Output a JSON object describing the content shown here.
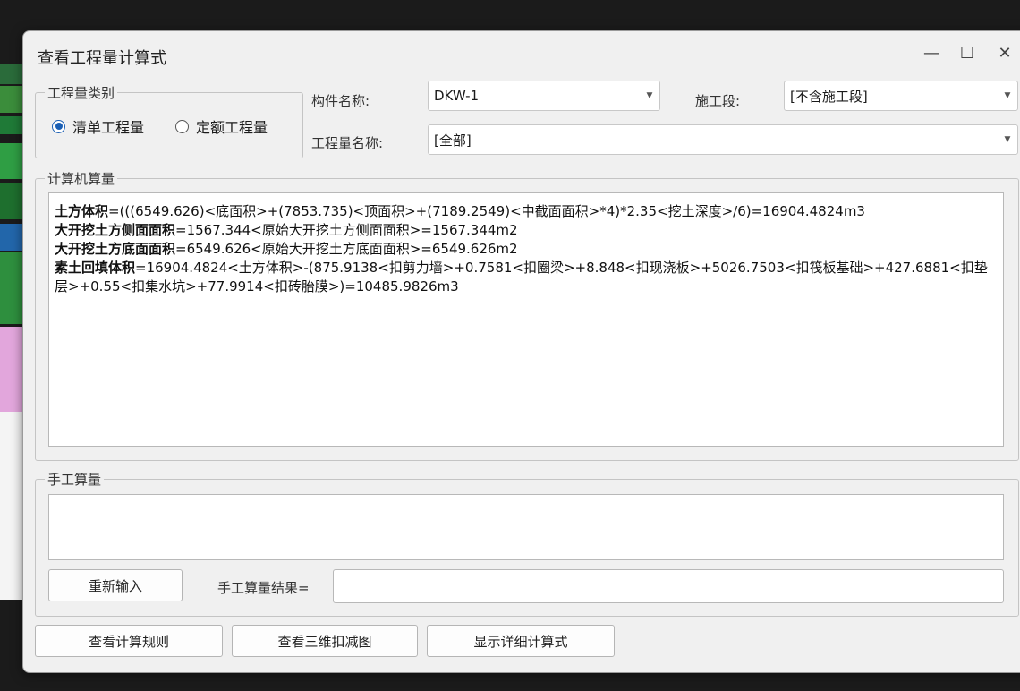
{
  "dialog": {
    "title": "查看工程量计算式",
    "minimize": "—",
    "maximize": "☐",
    "close": "✕"
  },
  "quantity_type": {
    "legend": "工程量类别",
    "options": [
      {
        "label": "清单工程量",
        "selected": true
      },
      {
        "label": "定额工程量",
        "selected": false
      }
    ]
  },
  "fields": {
    "component_name_label": "构件名称:",
    "component_name_value": "DKW-1",
    "stage_label": "施工段:",
    "stage_value": "[不含施工段]",
    "quantity_name_label": "工程量名称:",
    "quantity_name_value": "[全部]"
  },
  "computer": {
    "legend": "计算机算量",
    "lines": [
      {
        "name": "土方体积",
        "expr": "=(((6549.626)<底面积>+(7853.735)<顶面积>+(7189.2549)<中截面面积>*4)*2.35<挖土深度>/6)=16904.4824m3"
      },
      {
        "name": "大开挖土方侧面面积",
        "expr": "=1567.344<原始大开挖土方侧面面积>=1567.344m2"
      },
      {
        "name": "大开挖土方底面面积",
        "expr": "=6549.626<原始大开挖土方底面面积>=6549.626m2"
      },
      {
        "name": "素土回填体积",
        "expr": "=16904.4824<土方体积>-(875.9138<扣剪力墙>+0.7581<扣圈梁>+8.848<扣现浇板>+5026.7503<扣筏板基础>+427.6881<扣垫层>+0.55<扣集水坑>+77.9914<扣砖胎膜>)=10485.9826m3"
      }
    ]
  },
  "manual": {
    "legend": "手工算量",
    "reenter_button": "重新输入",
    "result_label": "手工算量结果=",
    "result_value": ""
  },
  "footer": {
    "rules_button": "查看计算规则",
    "view3d_button": "查看三维扣减图",
    "detail_button": "显示详细计算式"
  }
}
